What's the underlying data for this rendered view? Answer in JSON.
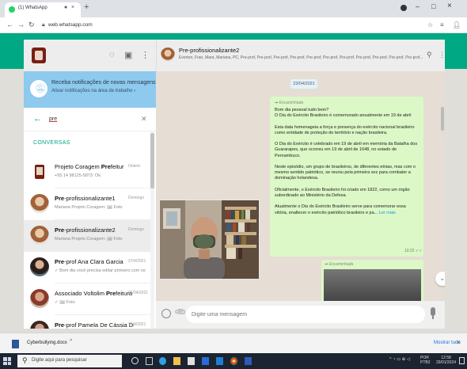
{
  "browser": {
    "tab_title": "(1) WhatsApp",
    "tab_close": "× ",
    "new_tab": "+",
    "url": "web.whatsapp.com",
    "minimize": "–",
    "maximize": "□",
    "close": "×"
  },
  "sidebar": {
    "notification": {
      "title": "Receba notificações de novas mensagens",
      "subtitle": "Ativar notificações na área de trabalho ›"
    },
    "search": {
      "value": "pre"
    },
    "section_label": "CONVERSAS",
    "chats": [
      {
        "name_pre": "Projeto Coragem ",
        "name_match": "Pre",
        "name_post": "feitur",
        "time": "Ontem",
        "preview": "+55 14 98125-5873: Ok."
      },
      {
        "name_pre": "",
        "name_match": "Pre",
        "name_post": "-profissionalizante1",
        "time": "Domingo",
        "preview": "Mariana Projeto Coragem: 🖼 Foto"
      },
      {
        "name_pre": "",
        "name_match": "Pre",
        "name_post": "-profissionalizante2",
        "time": "Domingo",
        "preview": "Mariana Projeto Coragem: 🖼 Foto"
      },
      {
        "name_pre": "",
        "name_match": "Pre",
        "name_post": "-prof Ana Clara Garcia",
        "time": "27/4/2021",
        "preview": "✓ Bom dia você precisa editar primeiro com os s..."
      },
      {
        "name_pre": "Associado Voltolim ",
        "name_match": "Pre",
        "name_post": "feitura",
        "time": "26/04/2021",
        "preview": "✓ 🖼 Foto"
      },
      {
        "name_pre": "",
        "name_match": "Pre",
        "name_post": "-prof Pamela De Cássia De",
        "time": "16/4/2021",
        "preview": ""
      }
    ]
  },
  "conversation": {
    "title": "Pre-profissionalizante2",
    "members": "Everton, Fran, Mara, Mariana, PC, Pre-prof, Pre-prof, Pre-prof, Pre-prof, Pre-prof, Pre-prof, Pre-prof, Pre-prof, Pre-prof, Pre-prof, Pre-prof...",
    "date": "23/04/2021",
    "message": {
      "forwarded": "➦ Encaminhada",
      "text": "Bom dia pessoal tudo bem?\nO Dia do Exército Brasileiro é comemorado anualmente em 19 de abril\n\nEsta data homenageia a força e presença do exército nacional brasileiro como entidade de proteção do território e nação brasileira.\n\nO Dia do Exército é celebrado em 19 de abril em memória da Batalha dos Guararapes, que ocorreu em 19 de abril de 1648, no estado de Pernambuco.\n\nNeste episódio, um grupo de brasileiros, de diferentes etnias, mas com o mesmo sentido patriótico, se reuniu pela primeira vez para combater a dominação holandesa.\n\nOficialmente, o Exército Brasileiro foi criado em 1822, como um órgão subordinado ao Ministério da Defesa.\n\nAtualmente o Dia do Exército Brasileiro serve para comemorar essa vitória, enaltecer o exército patriótico brasileiro e pa...",
      "read_more": " Ler mais",
      "time": "10:22 ✓✓"
    },
    "message2": {
      "forwarded": "➦ Encaminhada"
    },
    "composer_placeholder": "Digite uma mensagem"
  },
  "download": {
    "filename": "Cyberbullying.docx",
    "caret": "^",
    "show_all": "Mostrar tudo",
    "close": "×"
  },
  "taskbar": {
    "search_placeholder": "Digite aqui para pesquisar",
    "tray_icons": "^ ◔ ▭ ⊕ ◁ ",
    "lang": "POR\nPTB2",
    "time": "12:58\n29/01/2024"
  },
  "colors": {
    "brand": "#00a884",
    "notification": "#8ec9ee",
    "outgoing": "#dcf8c6",
    "chat_bg": "#e6ddd4"
  }
}
